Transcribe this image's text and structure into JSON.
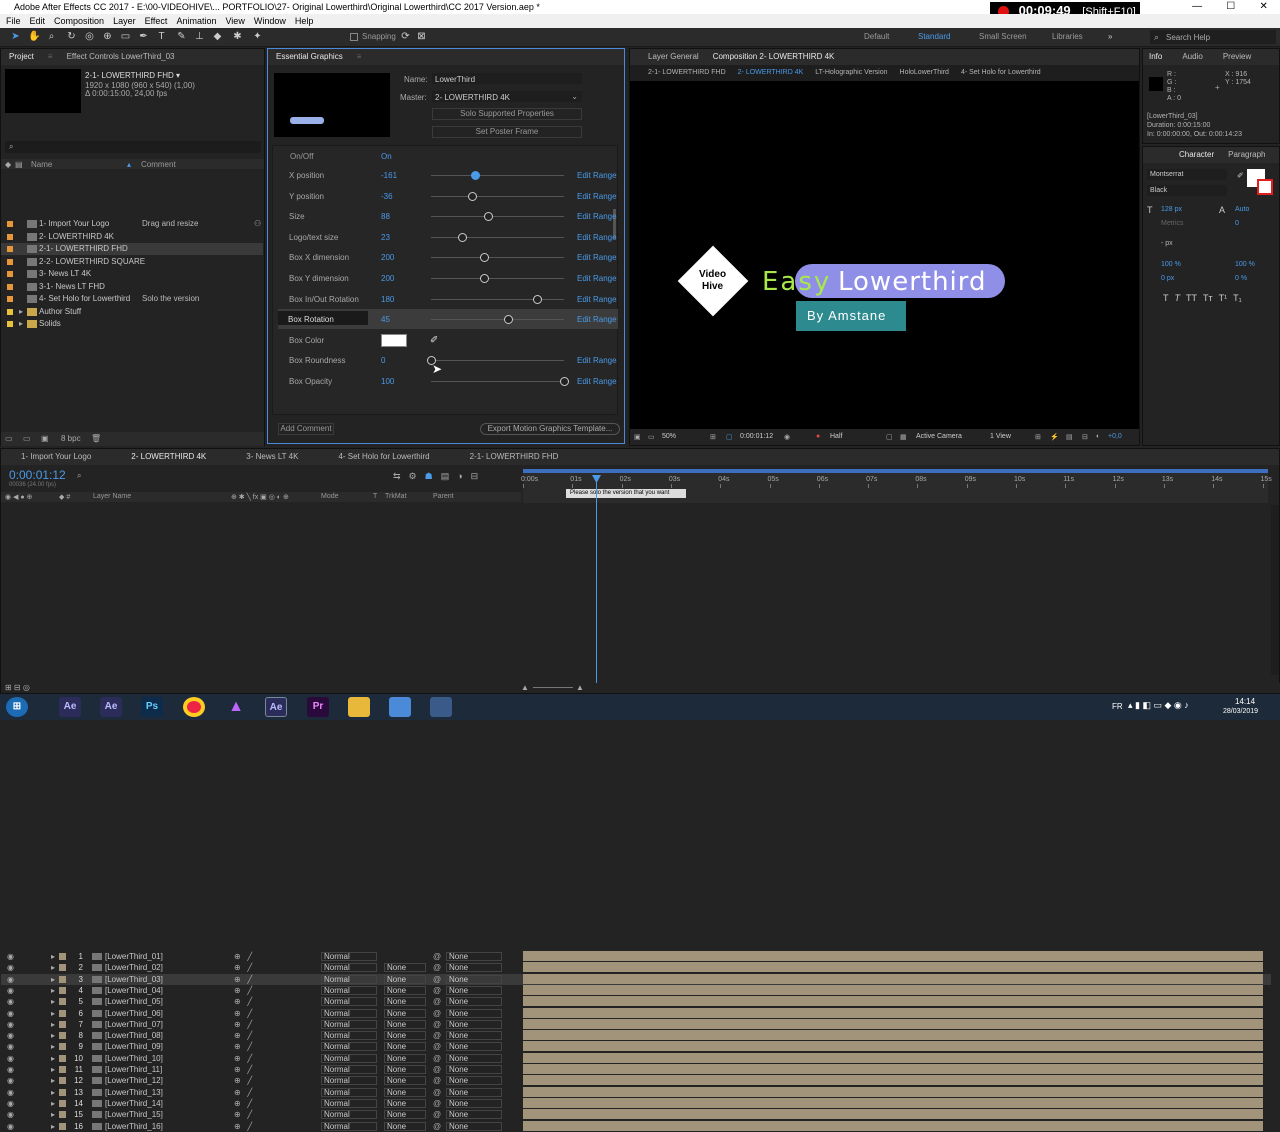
{
  "window": {
    "title": "Adobe After Effects CC 2017 - E:\\00-VIDEOHIVE\\... PORTFOLIO\\27- Original Lowerthird\\Original Lowerthird\\CC 2017 Version.aep *",
    "recording_time": "00:09:49",
    "recording_shortcut": "[Shift+F10]",
    "minimize": "—",
    "maximize": "☐",
    "close": "✕"
  },
  "menu": [
    "File",
    "Edit",
    "Composition",
    "Layer",
    "Effect",
    "Animation",
    "View",
    "Window",
    "Help"
  ],
  "toolbar": {
    "snapping": "Snapping",
    "workspaces": [
      "Default",
      "Standard",
      "Small Screen",
      "Libraries"
    ],
    "search_placeholder": "Search Help"
  },
  "project_panel": {
    "tab_project": "Project",
    "tab_effect_controls": "Effect Controls LowerThird_03",
    "selected_name": "2-1- LOWERTHIRD FHD ▾",
    "selected_info1": "1920 x 1080  (960 x 540) (1,00)",
    "selected_info2": "Δ 0:00:15:00, 24,00 fps",
    "search_placeholder": "",
    "col_name": "Name",
    "col_comment": "Comment",
    "items": [
      {
        "name": "1- Import Your Logo",
        "comment": "Drag and resize",
        "color": "#e8963a"
      },
      {
        "name": "2- LOWERTHIRD 4K",
        "comment": "",
        "color": "#e8963a"
      },
      {
        "name": "2-1- LOWERTHIRD FHD",
        "comment": "",
        "color": "#e8963a"
      },
      {
        "name": "2-2- LOWERTHIRD SQUARE",
        "comment": "",
        "color": "#e8963a"
      },
      {
        "name": "3- News LT 4K",
        "comment": "",
        "color": "#e8963a"
      },
      {
        "name": "3-1- News LT FHD",
        "comment": "",
        "color": "#e8963a"
      },
      {
        "name": "4- Set Holo for Lowerthird",
        "comment": "Solo the version",
        "color": "#e8963a"
      },
      {
        "name": "Author Stuff",
        "comment": "",
        "color": "#e8c23a"
      },
      {
        "name": "Solids",
        "comment": "",
        "color": "#e8c23a"
      }
    ],
    "bpc": "8 bpc"
  },
  "essential_graphics": {
    "tab": "Essential Graphics",
    "name_label": "Name:",
    "name_value": "LowerThird",
    "master_label": "Master:",
    "master_value": "2- LOWERTHIRD 4K",
    "solo_button": "Solo Supported Properties",
    "poster_button": "Set Poster Frame",
    "onoff_label": "On/Off",
    "onoff_value": "On",
    "properties": [
      {
        "label": "X position",
        "value": "-161",
        "level": 0.33
      },
      {
        "label": "Y position",
        "value": "-36",
        "level": 0.31
      },
      {
        "label": "Size",
        "value": "88",
        "level": 0.43
      },
      {
        "label": "Logo/text size",
        "value": "23",
        "level": 0.23
      },
      {
        "label": "Box X dimension",
        "value": "200",
        "level": 0.4
      },
      {
        "label": "Box Y dimension",
        "value": "200",
        "level": 0.4
      },
      {
        "label": "Box In/Out Rotation",
        "value": "180",
        "level": 0.8
      },
      {
        "label": "Box Rotation",
        "value": "45",
        "level": 0.58
      },
      {
        "label": "Box Color",
        "value": "",
        "level": null
      },
      {
        "label": "Box Roundness",
        "value": "0",
        "level": 0.0
      },
      {
        "label": "Box Opacity",
        "value": "100",
        "level": 1.0
      }
    ],
    "edit_range": "Edit Range",
    "add_comment": "Add Comment",
    "export_button": "Export Motion Graphics Template..."
  },
  "composition_panel": {
    "tab_layer": "Layer  General",
    "tab_comp": "Composition 2- LOWERTHIRD 4K",
    "breadcrumbs": [
      "2-1- LOWERTHIRD FHD",
      "2- LOWERTHIRD 4K",
      "LT-Holographic Version",
      "HoloLowerThird",
      "4- Set Holo for Lowerthird"
    ],
    "logo_line1": "Video",
    "logo_line2": "Hive",
    "title_word1": "Easy",
    "title_word2": "Lowerthird",
    "subtitle": "By Amstane",
    "zoom": "50%",
    "timecode": "0:00:01:12",
    "resolution": "Half",
    "camera": "Active Camera",
    "views": "1 View",
    "exposure": "+0,0"
  },
  "info_panel": {
    "tabs": [
      "Info",
      "Audio",
      "Preview"
    ],
    "r": "R :",
    "g": "G :",
    "b": "B :",
    "a": "A : 0",
    "x": "X : 916",
    "y": "Y : 1754",
    "layer": "[LowerThird_03]",
    "duration": "Duration: 0:00:15:00",
    "inout": "In: 0:00:00:00, Out: 0:00:14:23"
  },
  "character_panel": {
    "tabs": [
      "Character",
      "Paragraph"
    ],
    "font": "Montserrat",
    "style": "Black",
    "size": "128 px",
    "leading": "Auto",
    "kerning": "Metrics",
    "tracking": "0",
    "stroke": "- px",
    "vscale": "100 %",
    "hscale": "100 %",
    "baseline": "0 px",
    "tsume": "0 %"
  },
  "timeline": {
    "tabs": [
      "1- Import Your Logo",
      "2- LOWERTHIRD 4K",
      "3- News LT 4K",
      "4- Set Holo for Lowerthird",
      "2-1- LOWERTHIRD FHD"
    ],
    "timecode": "0:00:01:12",
    "fps_info": "00036 (24.00 fps)",
    "col_layer": "Layer Name",
    "col_mode": "Mode",
    "col_t": "T",
    "col_trkmat": "TrkMat",
    "col_parent": "Parent",
    "ruler": [
      "0:00s",
      "01s",
      "02s",
      "03s",
      "04s",
      "05s",
      "06s",
      "07s",
      "08s",
      "09s",
      "10s",
      "11s",
      "12s",
      "13s",
      "14s",
      "15s"
    ],
    "marker_text": "Please solo the version that you want",
    "layers": [
      {
        "num": "1",
        "name": "[LowerThird_01]",
        "mode": "Normal",
        "trkmat": "",
        "parent": "None"
      },
      {
        "num": "2",
        "name": "[LowerThird_02]",
        "mode": "Normal",
        "trkmat": "None",
        "parent": "None"
      },
      {
        "num": "3",
        "name": "[LowerThird_03]",
        "mode": "Normal",
        "trkmat": "None",
        "parent": "None"
      },
      {
        "num": "4",
        "name": "[LowerThird_04]",
        "mode": "Normal",
        "trkmat": "None",
        "parent": "None"
      },
      {
        "num": "5",
        "name": "[LowerThird_05]",
        "mode": "Normal",
        "trkmat": "None",
        "parent": "None"
      },
      {
        "num": "6",
        "name": "[LowerThird_06]",
        "mode": "Normal",
        "trkmat": "None",
        "parent": "None"
      },
      {
        "num": "7",
        "name": "[LowerThird_07]",
        "mode": "Normal",
        "trkmat": "None",
        "parent": "None"
      },
      {
        "num": "8",
        "name": "[LowerThird_08]",
        "mode": "Normal",
        "trkmat": "None",
        "parent": "None"
      },
      {
        "num": "9",
        "name": "[LowerThird_09]",
        "mode": "Normal",
        "trkmat": "None",
        "parent": "None"
      },
      {
        "num": "10",
        "name": "[LowerThird_10]",
        "mode": "Normal",
        "trkmat": "None",
        "parent": "None"
      },
      {
        "num": "11",
        "name": "[LowerThird_11]",
        "mode": "Normal",
        "trkmat": "None",
        "parent": "None"
      },
      {
        "num": "12",
        "name": "[LowerThird_12]",
        "mode": "Normal",
        "trkmat": "None",
        "parent": "None"
      },
      {
        "num": "13",
        "name": "[LowerThird_13]",
        "mode": "Normal",
        "trkmat": "None",
        "parent": "None"
      },
      {
        "num": "14",
        "name": "[LowerThird_14]",
        "mode": "Normal",
        "trkmat": "None",
        "parent": "None"
      },
      {
        "num": "15",
        "name": "[LowerThird_15]",
        "mode": "Normal",
        "trkmat": "None",
        "parent": "None"
      },
      {
        "num": "16",
        "name": "[LowerThird_16]",
        "mode": "Normal",
        "trkmat": "None",
        "parent": "None"
      }
    ]
  },
  "taskbar": {
    "apps": [
      "Ae",
      "Ae",
      "Ps",
      "Chrome",
      "Ae",
      "Ae",
      "Pr",
      "Explorer",
      "Network",
      "Steam"
    ],
    "lang": "FR",
    "time": "14:14",
    "date": "28/03/2019"
  },
  "colors": {
    "accent": "#4a9ae8",
    "lowerthird_purple": "#8f8fe8",
    "lowerthird_green": "#a8e84a",
    "lowerthird_teal": "#2d8a8f",
    "layer_bar": "#a1947a"
  }
}
